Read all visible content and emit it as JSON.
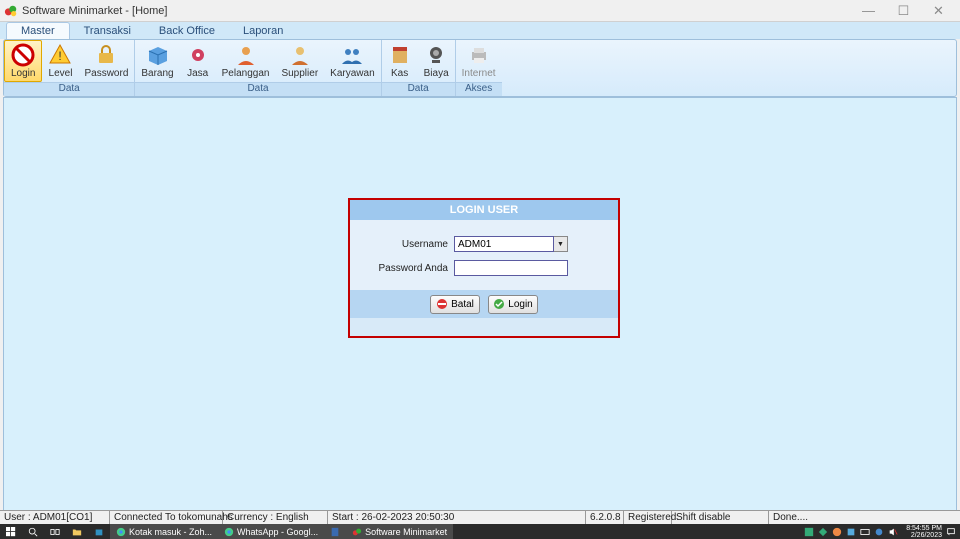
{
  "window": {
    "title": "Software Minimarket - [Home]"
  },
  "menu": {
    "tabs": [
      "Master",
      "Transaksi",
      "Back Office",
      "Laporan"
    ],
    "active": 0
  },
  "ribbon": {
    "groups": [
      {
        "label": "Data",
        "items": [
          {
            "name": "Login",
            "icon": "no"
          },
          {
            "name": "Level",
            "icon": "warn"
          },
          {
            "name": "Password",
            "icon": "lock"
          }
        ],
        "selected": 0
      },
      {
        "label": "Data",
        "items": [
          {
            "name": "Barang",
            "icon": "box"
          },
          {
            "name": "Jasa",
            "icon": "gear"
          },
          {
            "name": "Pelanggan",
            "icon": "person"
          },
          {
            "name": "Supplier",
            "icon": "supplier"
          },
          {
            "name": "Karyawan",
            "icon": "group"
          }
        ]
      },
      {
        "label": "Data",
        "items": [
          {
            "name": "Kas",
            "icon": "book"
          },
          {
            "name": "Biaya",
            "icon": "cam"
          }
        ]
      },
      {
        "label": "Akses",
        "items": [
          {
            "name": "Internet",
            "icon": "print",
            "disabled": true
          }
        ]
      }
    ]
  },
  "login": {
    "title": "LOGIN USER",
    "username_label": "Username",
    "username_value": "ADM01",
    "password_label": "Password Anda",
    "password_value": "",
    "btn_cancel": "Batal",
    "btn_ok": "Login"
  },
  "status": {
    "user": "User : ADM01[CO1]",
    "conn": "Connected To tokomunahs",
    "curr": "Currency : English",
    "start": "Start  : 26-02-2023 20:50:30",
    "ver": "6.2.0.8",
    "reg": "Registered.",
    "shift": "Shift disable",
    "done": "Done...."
  },
  "taskbar": {
    "items": [
      {
        "name": "start",
        "label": ""
      },
      {
        "name": "search",
        "label": ""
      },
      {
        "name": "taskview",
        "label": ""
      },
      {
        "name": "explorer",
        "label": ""
      },
      {
        "name": "store",
        "label": ""
      },
      {
        "name": "chrome1",
        "label": "Kotak masuk - Zoh..."
      },
      {
        "name": "chrome2",
        "label": "WhatsApp - Googl..."
      },
      {
        "name": "calc",
        "label": ""
      },
      {
        "name": "app",
        "label": "Software Minimarket"
      }
    ],
    "clock_time": "8:54:55 PM",
    "clock_date": "2/26/2023"
  }
}
